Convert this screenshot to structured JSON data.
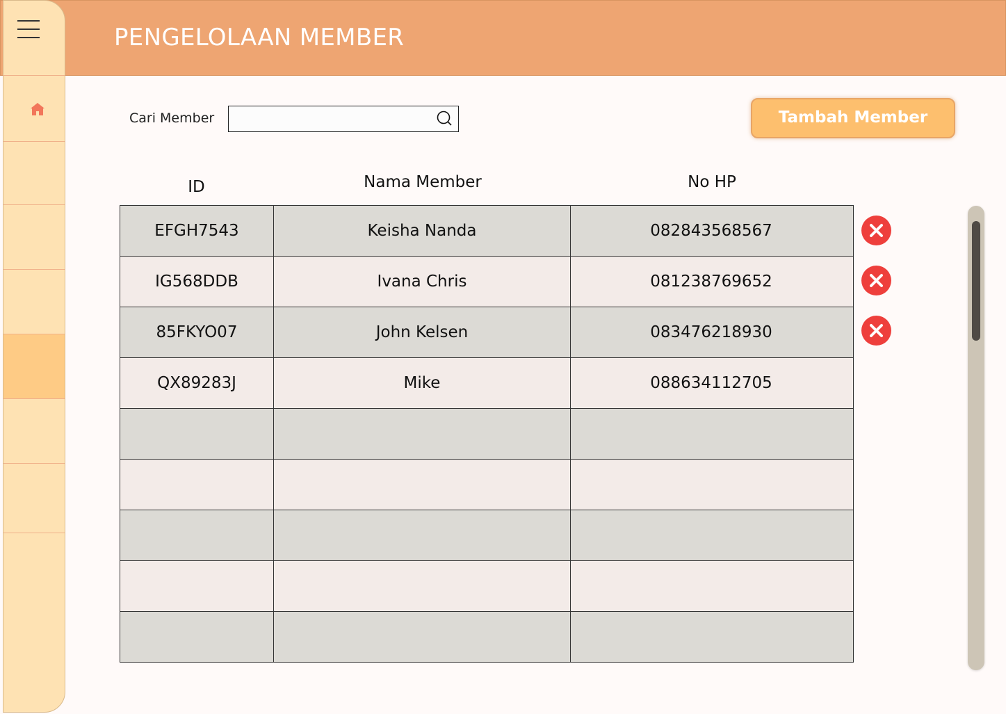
{
  "header": {
    "title": "PENGELOLAAN MEMBER"
  },
  "sidebar": {
    "icons": [
      "menu-icon",
      "home-icon"
    ],
    "active_item": 4
  },
  "search": {
    "label": "Cari Member",
    "value": "",
    "placeholder": ""
  },
  "actions": {
    "add_label": "Tambah Member"
  },
  "table": {
    "headers": {
      "id": "ID",
      "name": "Nama Member",
      "phone": "No HP"
    },
    "rows": [
      {
        "id": "EFGH7543",
        "name": "Keisha Nanda",
        "phone": "082843568567"
      },
      {
        "id": "IG568DDB",
        "name": "Ivana Chris",
        "phone": "081238769652"
      },
      {
        "id": "85FKYO07",
        "name": "John Kelsen",
        "phone": "083476218930"
      },
      {
        "id": "QX89283J",
        "name": "Mike",
        "phone": "088634112705"
      },
      {
        "id": "",
        "name": "",
        "phone": ""
      },
      {
        "id": "",
        "name": "",
        "phone": ""
      },
      {
        "id": "",
        "name": "",
        "phone": ""
      },
      {
        "id": "",
        "name": "",
        "phone": ""
      },
      {
        "id": "",
        "name": "",
        "phone": ""
      }
    ]
  },
  "colors": {
    "header": "#eea572",
    "sidebar": "#fee2b3",
    "sidebar_active": "#fecb85",
    "add_button": "#fdbf6e",
    "delete": "#ee3f3c",
    "row_dark": "#dcdad5",
    "row_light": "#f3ebe8"
  }
}
